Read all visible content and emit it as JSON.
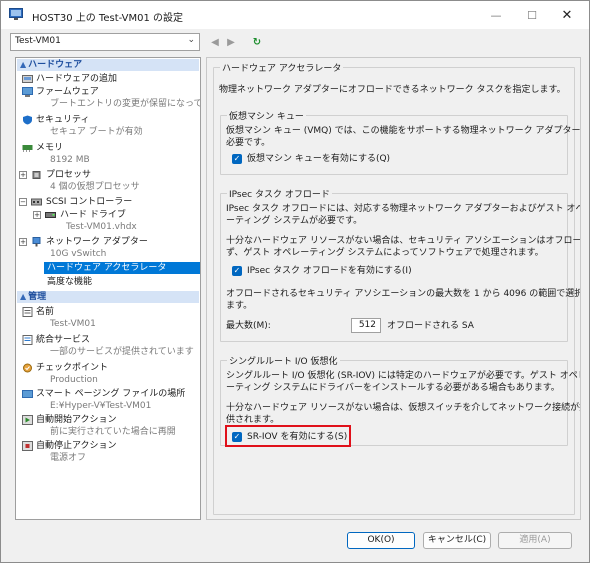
{
  "window": {
    "title": "HOST30 上の Test-VM01 の設定",
    "minimize": "—",
    "maximize": "☐",
    "close": "✕"
  },
  "toolbar": {
    "vm_selected": "Test-VM01",
    "back": "◀",
    "forward": "▶",
    "refresh": "↻"
  },
  "sidebar": {
    "hardware_header": "ハードウェア",
    "management_header": "管理",
    "hardware_items": [
      {
        "label": "ハードウェアの追加"
      },
      {
        "label": "ファームウェア",
        "sub": "ブートエントリの変更が保留になって..."
      },
      {
        "label": "セキュリティ",
        "sub": "セキュア ブートが有効"
      },
      {
        "label": "メモリ",
        "sub": "8192 MB"
      },
      {
        "label": "プロセッサ",
        "sub": "4 個の仮想プロセッサ"
      },
      {
        "label": "SCSI コントローラー"
      },
      {
        "label": "ハード ドライブ",
        "sub": "Test-VM01.vhdx"
      },
      {
        "label": "ネットワーク アダプター",
        "sub": "10G vSwitch"
      },
      {
        "label": "ハードウェア アクセラレータ"
      },
      {
        "label": "高度な機能"
      }
    ],
    "management_items": [
      {
        "label": "名前",
        "sub": "Test-VM01"
      },
      {
        "label": "統合サービス",
        "sub": "一部のサービスが提供されています"
      },
      {
        "label": "チェックポイント",
        "sub": "Production"
      },
      {
        "label": "スマート ページング ファイルの場所",
        "sub": "E:¥Hyper-V¥Test-VM01"
      },
      {
        "label": "自動開始アクション",
        "sub": "前に実行されていた場合に再開"
      },
      {
        "label": "自動停止アクション",
        "sub": "電源オフ"
      }
    ]
  },
  "main": {
    "section_title": "ハードウェア アクセラレータ",
    "intro": "物理ネットワーク アダプターにオフロードできるネットワーク タスクを指定します。",
    "vmq": {
      "title": "仮想マシン キュー",
      "desc_line1": "仮想マシン キュー (VMQ) では、この機能をサポートする物理ネットワーク アダプターが",
      "desc_line2": "必要です。",
      "checkbox_label": "仮想マシン キューを有効にする(Q)"
    },
    "ipsec": {
      "title": "IPsec タスク オフロード",
      "desc1_line1": "IPsec タスク オフロードには、対応する物理ネットワーク アダプターおよびゲスト オペレ",
      "desc1_line2": "ーティング システムが必要です。",
      "desc2_line1": "十分なハードウェア リソースがない場合は、セキュリティ アソシエーションはオフロードされ",
      "desc2_line2": "ず、ゲスト オペレーティング システムによってソフトウェアで処理されます。",
      "checkbox_label": "IPsec タスク オフロードを有効にする(I)",
      "desc3_line1": "オフロードされるセキュリティ アソシエーションの最大数を 1 から 4096 の範囲で選択し",
      "desc3_line2": "ます。",
      "max_label": "最大数(M):",
      "max_value": "512",
      "max_suffix": "オフロードされる SA"
    },
    "sriov": {
      "title": "シングルルート I/O 仮想化",
      "desc1_line1": "シングルルート I/O 仮想化 (SR-IOV) には特定のハードウェアが必要です。ゲスト オペレ",
      "desc1_line2": "ーティング システムにドライバーをインストールする必要がある場合もあります。",
      "desc2_line1": "十分なハードウェア リソースがない場合は、仮想スイッチを介してネットワーク接続が提",
      "desc2_line2": "供されます。",
      "checkbox_label": "SR-IOV を有効にする(S)"
    }
  },
  "buttons": {
    "ok": "OK(O)",
    "cancel": "キャンセル(C)",
    "apply": "適用(A)"
  },
  "colors": {
    "accent": "#0078d7",
    "highlight": "#e0101a",
    "section_header_bg": "#d5e3f6"
  }
}
